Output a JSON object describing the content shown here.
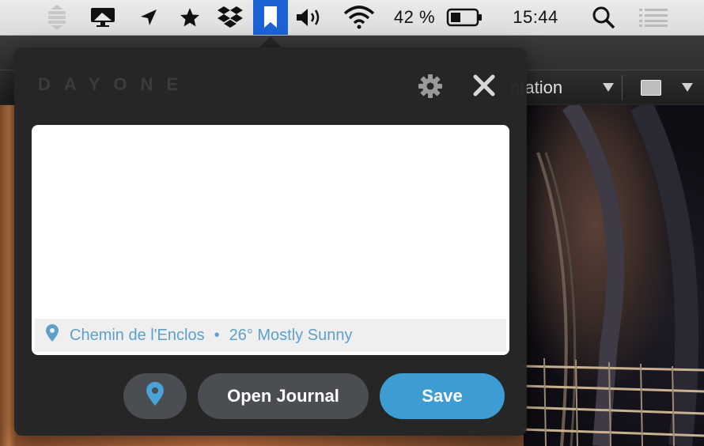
{
  "menubar": {
    "battery_percent": "42 %",
    "battery_level": 0.42,
    "clock": "15:44",
    "icons": [
      "sidebar-list-icon",
      "display-icon",
      "location-arrow-icon",
      "star-icon",
      "dropbox-icon",
      "dayone-bookmark-icon",
      "volume-icon",
      "wifi-icon",
      "battery-icon",
      "spotlight-icon",
      "notification-list-icon"
    ],
    "active_color": "#1b63d4"
  },
  "background_app": {
    "toolbar_text": "ntation"
  },
  "popover": {
    "logo": "DAYONE",
    "settings_icon": "gear-icon",
    "close_icon": "close-icon",
    "entry_text": "",
    "location": "Chemin de l'Enclos",
    "separator": "•",
    "weather": "26° Mostly Sunny",
    "buttons": {
      "location_icon": "location-pin-icon",
      "open_journal": "Open Journal",
      "save": "Save"
    },
    "accent_color": "#3d9dd2",
    "meta_color": "#5ea0c9"
  }
}
